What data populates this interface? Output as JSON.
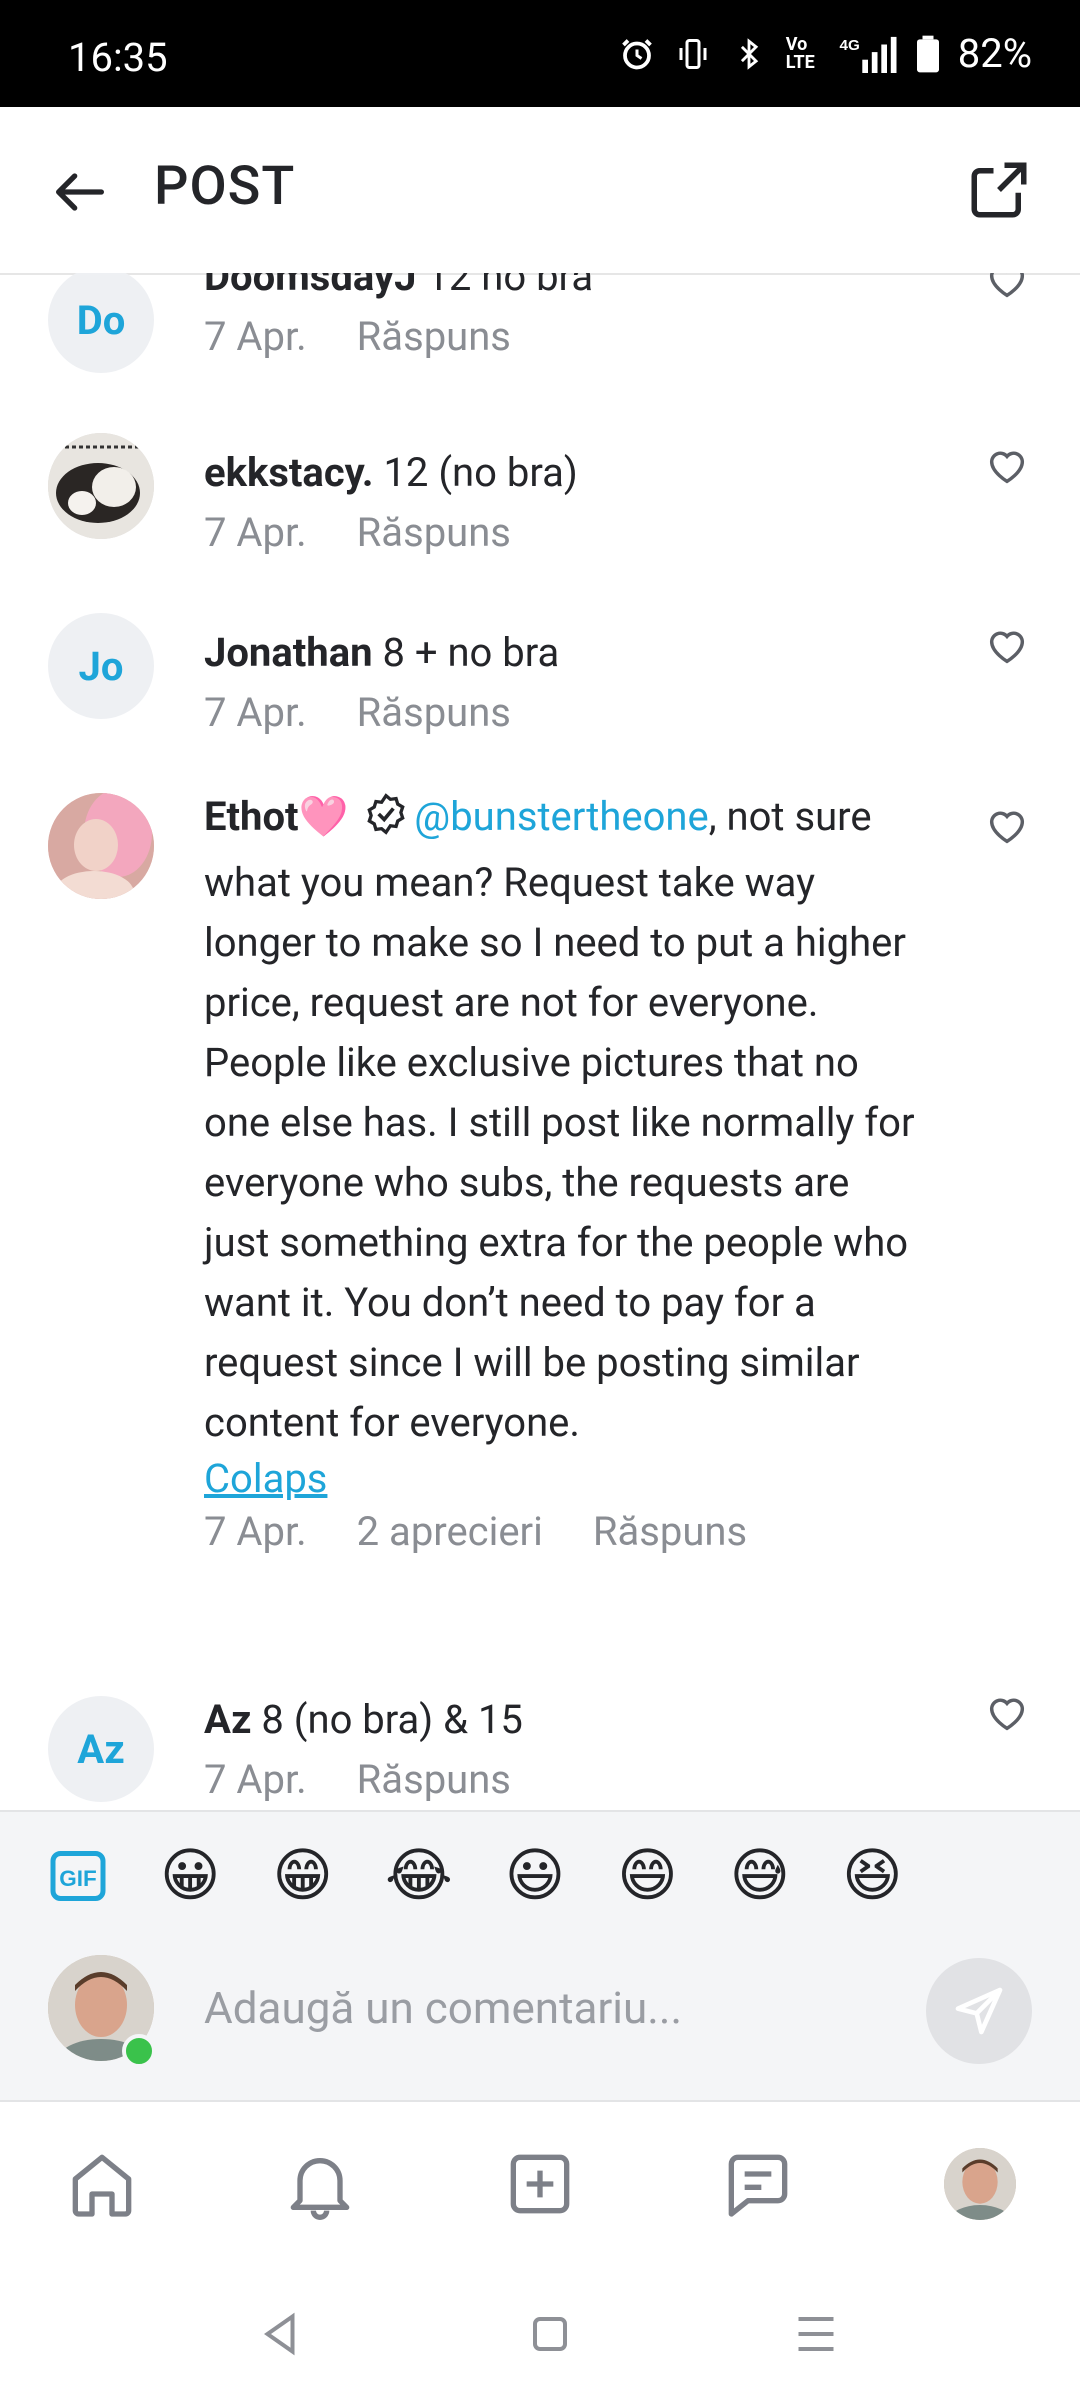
{
  "status_bar": {
    "time": "16:35",
    "battery": "82%",
    "icons": [
      "alarm-icon",
      "vibrate-icon",
      "bluetooth-icon",
      "volte-icon",
      "4g-signal-icon",
      "battery-icon"
    ],
    "volte_label": "Vo LTE",
    "network_label": "4G"
  },
  "header": {
    "title": "POST",
    "back_icon": "arrow-left-icon",
    "share_icon": "share-icon"
  },
  "comments": [
    {
      "initials": "Do",
      "name": "DoomsdayJ",
      "text": " 12 no bra",
      "date": "7 Apr.",
      "reply": "Răspuns"
    },
    {
      "initials": "",
      "name": "ekkstacy.",
      "text": " 12 (no bra)",
      "date": "7 Apr.",
      "reply": "Răspuns"
    },
    {
      "initials": "Jo",
      "name": "Jonathan",
      "text": " 8 + no bra",
      "date": "7 Apr.",
      "reply": "Răspuns"
    },
    {
      "initials": "",
      "name": "Ethot",
      "name_emoji": "🩷",
      "mention": "@bunstertheone",
      "text": ", not sure what you mean? Request take way longer to make so I need to put a higher price, request are not for everyone. People like exclusive pictures that no one else has. I still post like normally for everyone who subs, the requests are just something extra for the people who want it. You don’t need to pay for a request since I will be posting similar content for everyone.",
      "collapse": "Colaps",
      "date": "7 Apr.",
      "likes": "2 aprecieri",
      "reply": "Răspuns"
    },
    {
      "initials": "Az",
      "name": "Az",
      "text": " 8 (no bra) & 15",
      "date": "7 Apr.",
      "reply": "Răspuns"
    }
  ],
  "composer": {
    "gif_label": "GIF",
    "emojis": [
      "😀",
      "😁",
      "😂",
      "😃",
      "😄",
      "😅",
      "😆"
    ],
    "placeholder": "Adaugă un comentariu..."
  },
  "bottom_nav": [
    "home-icon",
    "bell-icon",
    "add-icon",
    "messages-icon",
    "profile-avatar"
  ],
  "colors": {
    "accent": "#1ea5d9",
    "meta": "#8a8d93",
    "online": "#3ac24b"
  }
}
